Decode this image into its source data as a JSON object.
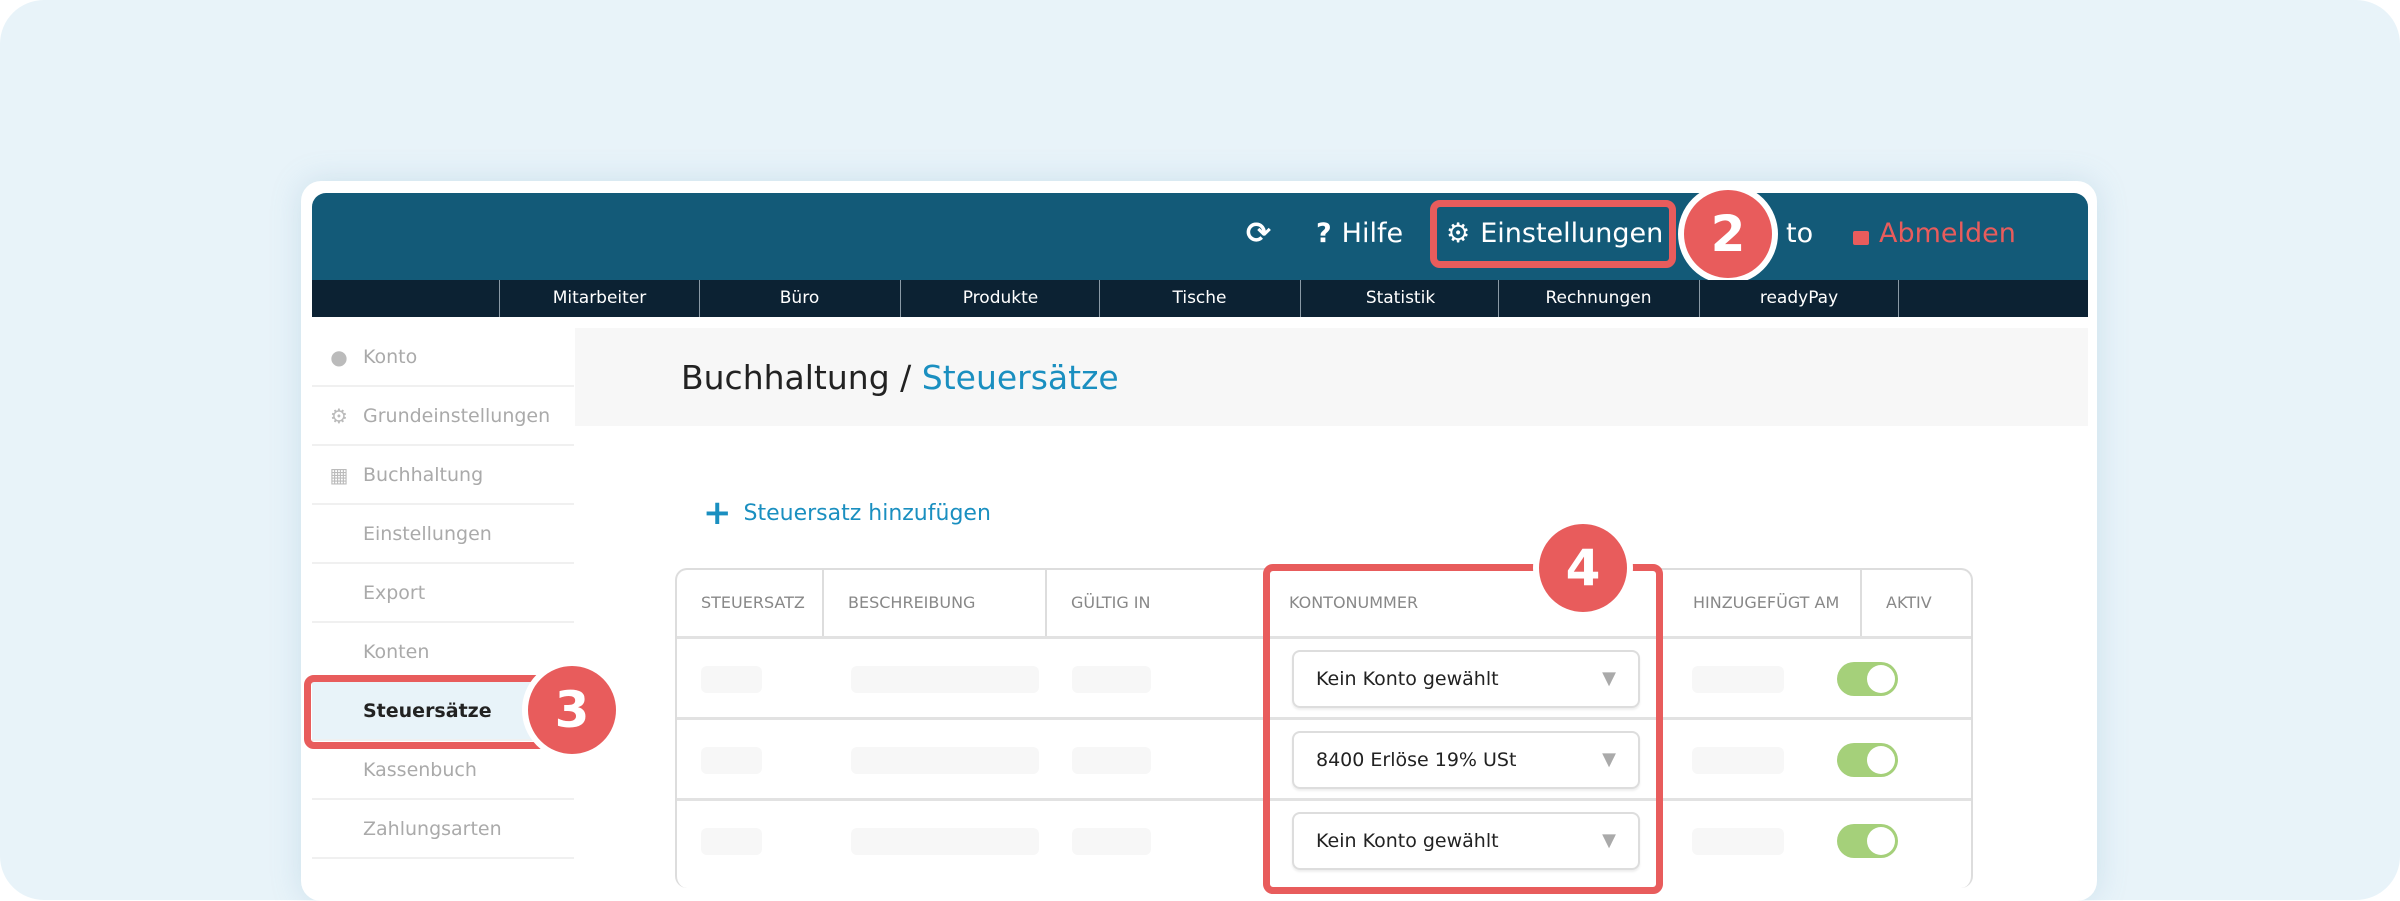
{
  "header": {
    "refresh_icon": "refresh-icon",
    "help": "Hilfe",
    "settings": "Einstellungen",
    "account_partial": "to",
    "logout": "Abmelden"
  },
  "nav": [
    "Mitarbeiter",
    "Büro",
    "Produkte",
    "Tische",
    "Statistik",
    "Rechnungen",
    "readyPay"
  ],
  "sidebar": [
    {
      "label": "Konto",
      "icon": "user-icon"
    },
    {
      "label": "Grundeinstellungen",
      "icon": "gear-icon"
    },
    {
      "label": "Buchhaltung",
      "icon": "calculator-icon"
    },
    {
      "label": "Einstellungen"
    },
    {
      "label": "Export"
    },
    {
      "label": "Konten"
    },
    {
      "label": "Steuersätze",
      "active": true
    },
    {
      "label": "Kassenbuch"
    },
    {
      "label": "Zahlungsarten"
    }
  ],
  "page": {
    "crumb": "Buchhaltung",
    "sep": " / ",
    "current": "Steuersätze",
    "add": "Steuersatz hinzufügen"
  },
  "table": {
    "headers": [
      "STEUERSATZ",
      "BESCHREIBUNG",
      "GÜLTIG IN",
      "KONTONUMMER",
      "HINZUGEFÜGT AM",
      "AKTIV"
    ],
    "rows": [
      {
        "konto": "Kein Konto gewählt",
        "aktiv": true
      },
      {
        "konto": "8400 Erlöse 19% USt",
        "aktiv": true
      },
      {
        "konto": "Kein Konto gewählt",
        "aktiv": true
      }
    ]
  },
  "badges": {
    "b2": "2",
    "b3": "3",
    "b4": "4"
  },
  "colors": {
    "header": "#135a78",
    "nav": "#0c2233",
    "accent": "#1a8fc0",
    "highlight": "#e85c5c",
    "toggle": "#a5d07a"
  }
}
